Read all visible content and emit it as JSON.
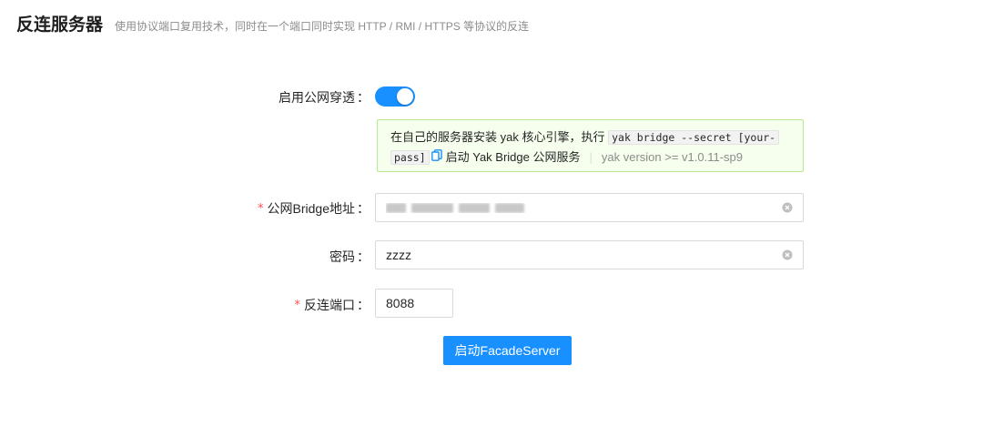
{
  "header": {
    "title": "反连服务器",
    "subtitle": "使用协议端口复用技术，同时在一个端口同时实现 HTTP / RMI / HTTPS 等协议的反连"
  },
  "form": {
    "public_tunnel": {
      "label": "启用公网穿透",
      "enabled": true
    },
    "alert": {
      "text_before": "在自己的服务器安装 yak 核心引擎，执行",
      "command": "yak bridge --secret [your-pass]",
      "command_line1": "yak bridge --secret [your-",
      "command_line2": "pass]",
      "text_after": "启动 Yak Bridge 公网服务",
      "version_note": "yak version >= v1.0.11-sp9"
    },
    "bridge_address": {
      "label": "公网Bridge地址",
      "required": "*",
      "value": ""
    },
    "password": {
      "label": "密码",
      "value": "zzzz"
    },
    "reverse_port": {
      "label": "反连端口",
      "required": "*",
      "value": "8088"
    },
    "colon": "："
  },
  "actions": {
    "submit_label": "启动FacadeServer"
  },
  "colors": {
    "primary": "#1890ff",
    "required": "#ff4d4f",
    "alert_bg": "#f6ffed",
    "alert_border": "#b7eb8f"
  }
}
